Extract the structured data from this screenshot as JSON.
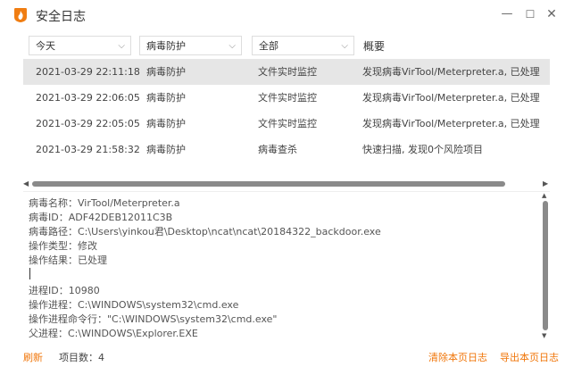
{
  "window": {
    "title": "安全日志",
    "minimize": "—",
    "maximize": "☐",
    "close": "✕",
    "accent": "#f07d12"
  },
  "filters": {
    "time": "今天",
    "category": "病毒防护",
    "scope": "全部",
    "summary_header": "概要"
  },
  "rows": [
    {
      "time": "2021-03-29 22:11:18",
      "category": "病毒防护",
      "source": "文件实时监控",
      "summary": "发现病毒VirTool/Meterpreter.a, 已处理",
      "selected": true
    },
    {
      "time": "2021-03-29 22:06:05",
      "category": "病毒防护",
      "source": "文件实时监控",
      "summary": "发现病毒VirTool/Meterpreter.a, 已处理",
      "selected": false
    },
    {
      "time": "2021-03-29 22:05:05",
      "category": "病毒防护",
      "source": "文件实时监控",
      "summary": "发现病毒VirTool/Meterpreter.a, 已处理",
      "selected": false
    },
    {
      "time": "2021-03-29 21:58:32",
      "category": "病毒防护",
      "source": "病毒查杀",
      "summary": "快速扫描, 发现0个风险项目",
      "selected": false
    }
  ],
  "detail": {
    "virus_name": "病毒名称：VirTool/Meterpreter.a",
    "virus_id": "病毒ID：ADF42DEB12011C3B",
    "virus_path": "病毒路径：C:\\Users\\yinkou君\\Desktop\\ncat\\ncat\\20184322_backdoor.exe",
    "op_type": "操作类型：修改",
    "op_result": "操作结果：已处理",
    "pid": "进程ID：10980",
    "process": "操作进程：C:\\WINDOWS\\system32\\cmd.exe",
    "cmdline": "操作进程命令行：\"C:\\WINDOWS\\system32\\cmd.exe\"",
    "parent": "父进程：C:\\WINDOWS\\Explorer.EXE"
  },
  "footer": {
    "refresh": "刷新",
    "count": "项目数：4",
    "clear": "清除本页日志",
    "export": "导出本页日志"
  }
}
